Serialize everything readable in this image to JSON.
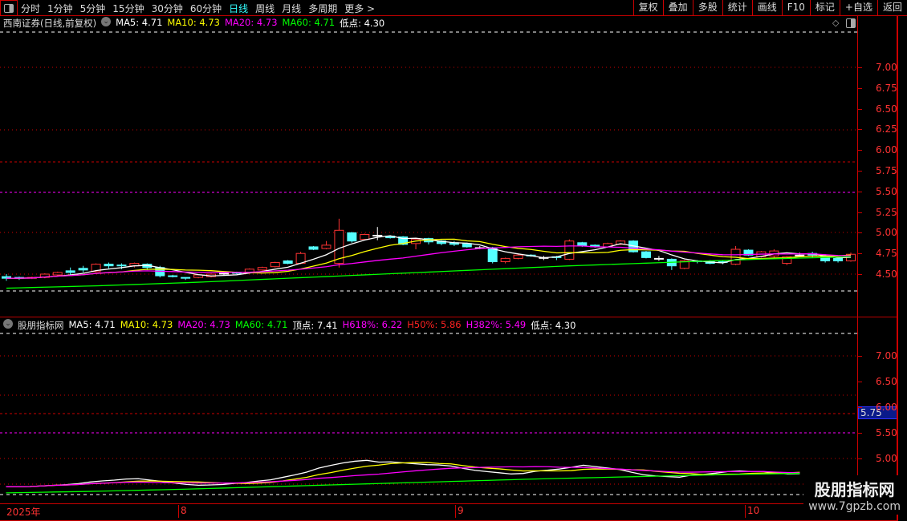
{
  "toolbar": {
    "periods": [
      "分时",
      "1分钟",
      "5分钟",
      "15分钟",
      "30分钟",
      "60分钟",
      "日线",
      "周线",
      "月线",
      "多周期",
      "更多 >"
    ],
    "active_period": "日线",
    "actions": [
      "复权",
      "叠加",
      "多股",
      "统计",
      "画线",
      "F10",
      "标记",
      "+自选",
      "返回"
    ]
  },
  "main_pane": {
    "title": "西南证券(日线,前复权)",
    "ma5": "MA5: 4.71",
    "ma10": "MA10: 4.73",
    "ma20": "MA20: 4.73",
    "ma60": "MA60: 4.71",
    "low": "低点: 4.30",
    "ticks": [
      "7.00",
      "6.75",
      "6.50",
      "6.25",
      "6.00",
      "5.75",
      "5.50",
      "5.25",
      "5.00",
      "4.75",
      "4.50"
    ]
  },
  "sub_pane": {
    "title": "股朋指标网",
    "ma5": "MA5: 4.71",
    "ma10": "MA10: 4.73",
    "ma20": "MA20: 4.73",
    "ma60": "MA60: 4.71",
    "top": "顶点: 7.41",
    "h618": "H618%: 6.22",
    "h50": "H50%: 5.86",
    "h382": "H382%: 5.49",
    "low": "低点: 4.30",
    "ticks": [
      "7.00",
      "6.50",
      "6.00",
      "5.50",
      "5.00"
    ],
    "cursor_value": "5.75"
  },
  "date_axis": [
    "2025年",
    "8",
    "9",
    "10"
  ],
  "watermark": {
    "name": "股朋指标网",
    "url": "www.7gpzb.com"
  },
  "colors": {
    "up": "#ff3333",
    "down": "#55ffff",
    "ma5": "#ffffff",
    "ma10": "#ffff00",
    "ma20": "#ff00ff",
    "ma60": "#00ff00"
  },
  "chart_data": {
    "type": "candlestick",
    "ylim_main": [
      4.3,
      7.4
    ],
    "candles_ochl": [
      [
        4.47,
        4.45,
        4.5,
        4.42
      ],
      [
        4.46,
        4.45,
        4.47,
        4.43
      ],
      [
        4.45,
        4.46,
        4.47,
        4.44
      ],
      [
        4.46,
        4.5,
        4.51,
        4.45
      ],
      [
        4.49,
        4.52,
        4.53,
        4.48
      ],
      [
        4.54,
        4.52,
        4.58,
        4.49
      ],
      [
        4.57,
        4.55,
        4.6,
        4.52
      ],
      [
        4.53,
        4.62,
        4.63,
        4.52
      ],
      [
        4.62,
        4.6,
        4.64,
        4.57
      ],
      [
        4.61,
        4.6,
        4.63,
        4.56
      ],
      [
        4.6,
        4.63,
        4.64,
        4.58
      ],
      [
        4.62,
        4.58,
        4.63,
        4.55
      ],
      [
        4.58,
        4.48,
        4.6,
        4.46
      ],
      [
        4.48,
        4.47,
        4.49,
        4.46
      ],
      [
        4.46,
        4.45,
        4.46,
        4.43
      ],
      [
        4.46,
        4.49,
        4.5,
        4.45
      ],
      [
        4.47,
        4.5,
        4.51,
        4.46
      ],
      [
        4.51,
        4.51,
        4.53,
        4.49
      ],
      [
        4.52,
        4.51,
        4.53,
        4.5
      ],
      [
        4.52,
        4.56,
        4.57,
        4.51
      ],
      [
        4.55,
        4.58,
        4.59,
        4.54
      ],
      [
        4.59,
        4.64,
        4.65,
        4.58
      ],
      [
        4.66,
        4.63,
        4.67,
        4.62
      ],
      [
        4.63,
        4.75,
        4.77,
        4.62
      ],
      [
        4.83,
        4.8,
        4.84,
        4.79
      ],
      [
        4.81,
        4.85,
        4.9,
        4.8
      ],
      [
        4.63,
        5.03,
        5.17,
        4.58
      ],
      [
        5.0,
        4.9,
        5.01,
        4.88
      ],
      [
        4.92,
        4.98,
        4.99,
        4.91
      ],
      [
        4.97,
        4.97,
        5.07,
        4.91
      ],
      [
        4.96,
        4.94,
        4.97,
        4.93
      ],
      [
        4.95,
        4.86,
        4.96,
        4.85
      ],
      [
        4.87,
        4.92,
        4.93,
        4.8
      ],
      [
        4.93,
        4.89,
        4.94,
        4.86
      ],
      [
        4.9,
        4.87,
        4.91,
        4.85
      ],
      [
        4.88,
        4.86,
        4.9,
        4.84
      ],
      [
        4.87,
        4.83,
        4.88,
        4.82
      ],
      [
        4.82,
        4.82,
        4.84,
        4.8
      ],
      [
        4.82,
        4.65,
        4.83,
        4.63
      ],
      [
        4.65,
        4.69,
        4.7,
        4.63
      ],
      [
        4.69,
        4.73,
        4.75,
        4.68
      ],
      [
        4.73,
        4.72,
        4.74,
        4.71
      ],
      [
        4.7,
        4.7,
        4.72,
        4.67
      ],
      [
        4.71,
        4.7,
        4.72,
        4.67
      ],
      [
        4.68,
        4.9,
        4.92,
        4.67
      ],
      [
        4.88,
        4.84,
        4.89,
        4.83
      ],
      [
        4.85,
        4.83,
        4.86,
        4.82
      ],
      [
        4.83,
        4.87,
        4.88,
        4.82
      ],
      [
        4.86,
        4.9,
        4.91,
        4.85
      ],
      [
        4.9,
        4.77,
        4.91,
        4.76
      ],
      [
        4.77,
        4.7,
        4.78,
        4.69
      ],
      [
        4.69,
        4.69,
        4.72,
        4.66
      ],
      [
        4.68,
        4.6,
        4.69,
        4.55
      ],
      [
        4.57,
        4.66,
        4.67,
        4.56
      ],
      [
        4.66,
        4.65,
        4.67,
        4.63
      ],
      [
        4.65,
        4.63,
        4.67,
        4.62
      ],
      [
        4.65,
        4.64,
        4.66,
        4.62
      ],
      [
        4.62,
        4.8,
        4.84,
        4.61
      ],
      [
        4.79,
        4.73,
        4.8,
        4.72
      ],
      [
        4.71,
        4.77,
        4.78,
        4.7
      ],
      [
        4.72,
        4.78,
        4.8,
        4.7
      ],
      [
        4.63,
        4.71,
        4.72,
        4.61
      ],
      [
        4.73,
        4.73,
        4.76,
        4.71
      ],
      [
        4.75,
        4.73,
        4.77,
        4.7
      ],
      [
        4.72,
        4.66,
        4.74,
        4.64
      ],
      [
        4.69,
        4.66,
        4.7,
        4.64
      ],
      [
        4.66,
        4.74,
        4.76,
        4.65
      ]
    ],
    "ma60_points": [
      4.33,
      4.36,
      4.4,
      4.45,
      4.5,
      4.55,
      4.6,
      4.64,
      4.68,
      4.71
    ]
  }
}
